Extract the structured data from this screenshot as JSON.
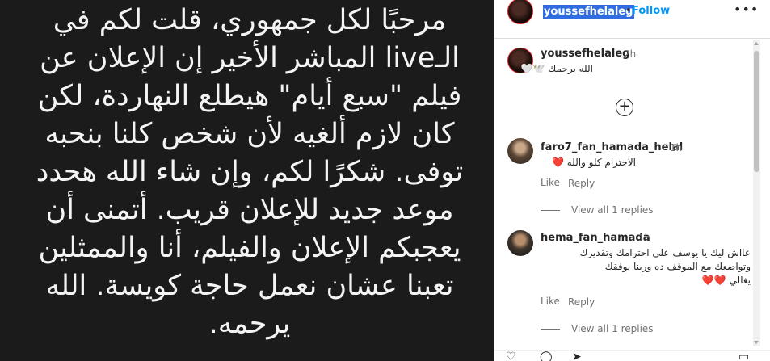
{
  "story": {
    "lines": [
      "مرحبًا لكل جمهوري، قلت لكم في",
      "الـlive المباشر الأخير إن الإعلان عن",
      "فيلم \"سبع أيام\" هيطلع النهاردة، لكن",
      "كان لازم ألغيه لأن شخص كلنا بنحبه",
      "توفى. شكرًا لكم، وإن شاء الله هحدد",
      "موعد جديد للإعلان قريب. أتمنى أن",
      "يعجبكم الإعلان والفيلم، أنا والممثلين",
      "تعبنا عشان نعمل حاجة كويسة. الله",
      "يرحمه."
    ]
  },
  "header": {
    "username": "youssefhelaleg",
    "separator": "•",
    "follow": "Follow",
    "more_icon": "more-horizontal-icon",
    "more_glyph": "•••"
  },
  "caption": {
    "username": "youssefhelaleg",
    "time": "2h",
    "text": "الله يرحمك 🕊️🤍"
  },
  "load_more_icon": "plus-circle-icon",
  "load_more_glyph": "+",
  "comments": [
    {
      "username": "faro7_fan_hamada_helal",
      "time": "1h",
      "text": "الاحترام كلو والله ❤️",
      "like": "Like",
      "reply": "Reply",
      "view_replies": "View all 1 replies"
    },
    {
      "username": "hema_fan_hamada",
      "time": "1h",
      "text_lines": [
        "عااش ليك يا يوسف علي احترامك وتقديرك",
        "وتواضعك مع الموقف ده وربنا يوفقك",
        "يغالي ❤️❤️"
      ],
      "like": "Like",
      "reply": "Reply",
      "view_replies": "View all 1 replies"
    }
  ],
  "actions": {
    "like_icon": "heart-icon",
    "comment_icon": "comment-icon",
    "share_icon": "share-icon",
    "save_icon": "bookmark-icon",
    "like_glyph": "♡",
    "comment_glyph": "◯",
    "share_glyph": "➤",
    "save_glyph": "▭"
  },
  "colors": {
    "accent": "#0095f6",
    "selection": "#2f6de0",
    "story_bg": "#1b1b1b"
  }
}
